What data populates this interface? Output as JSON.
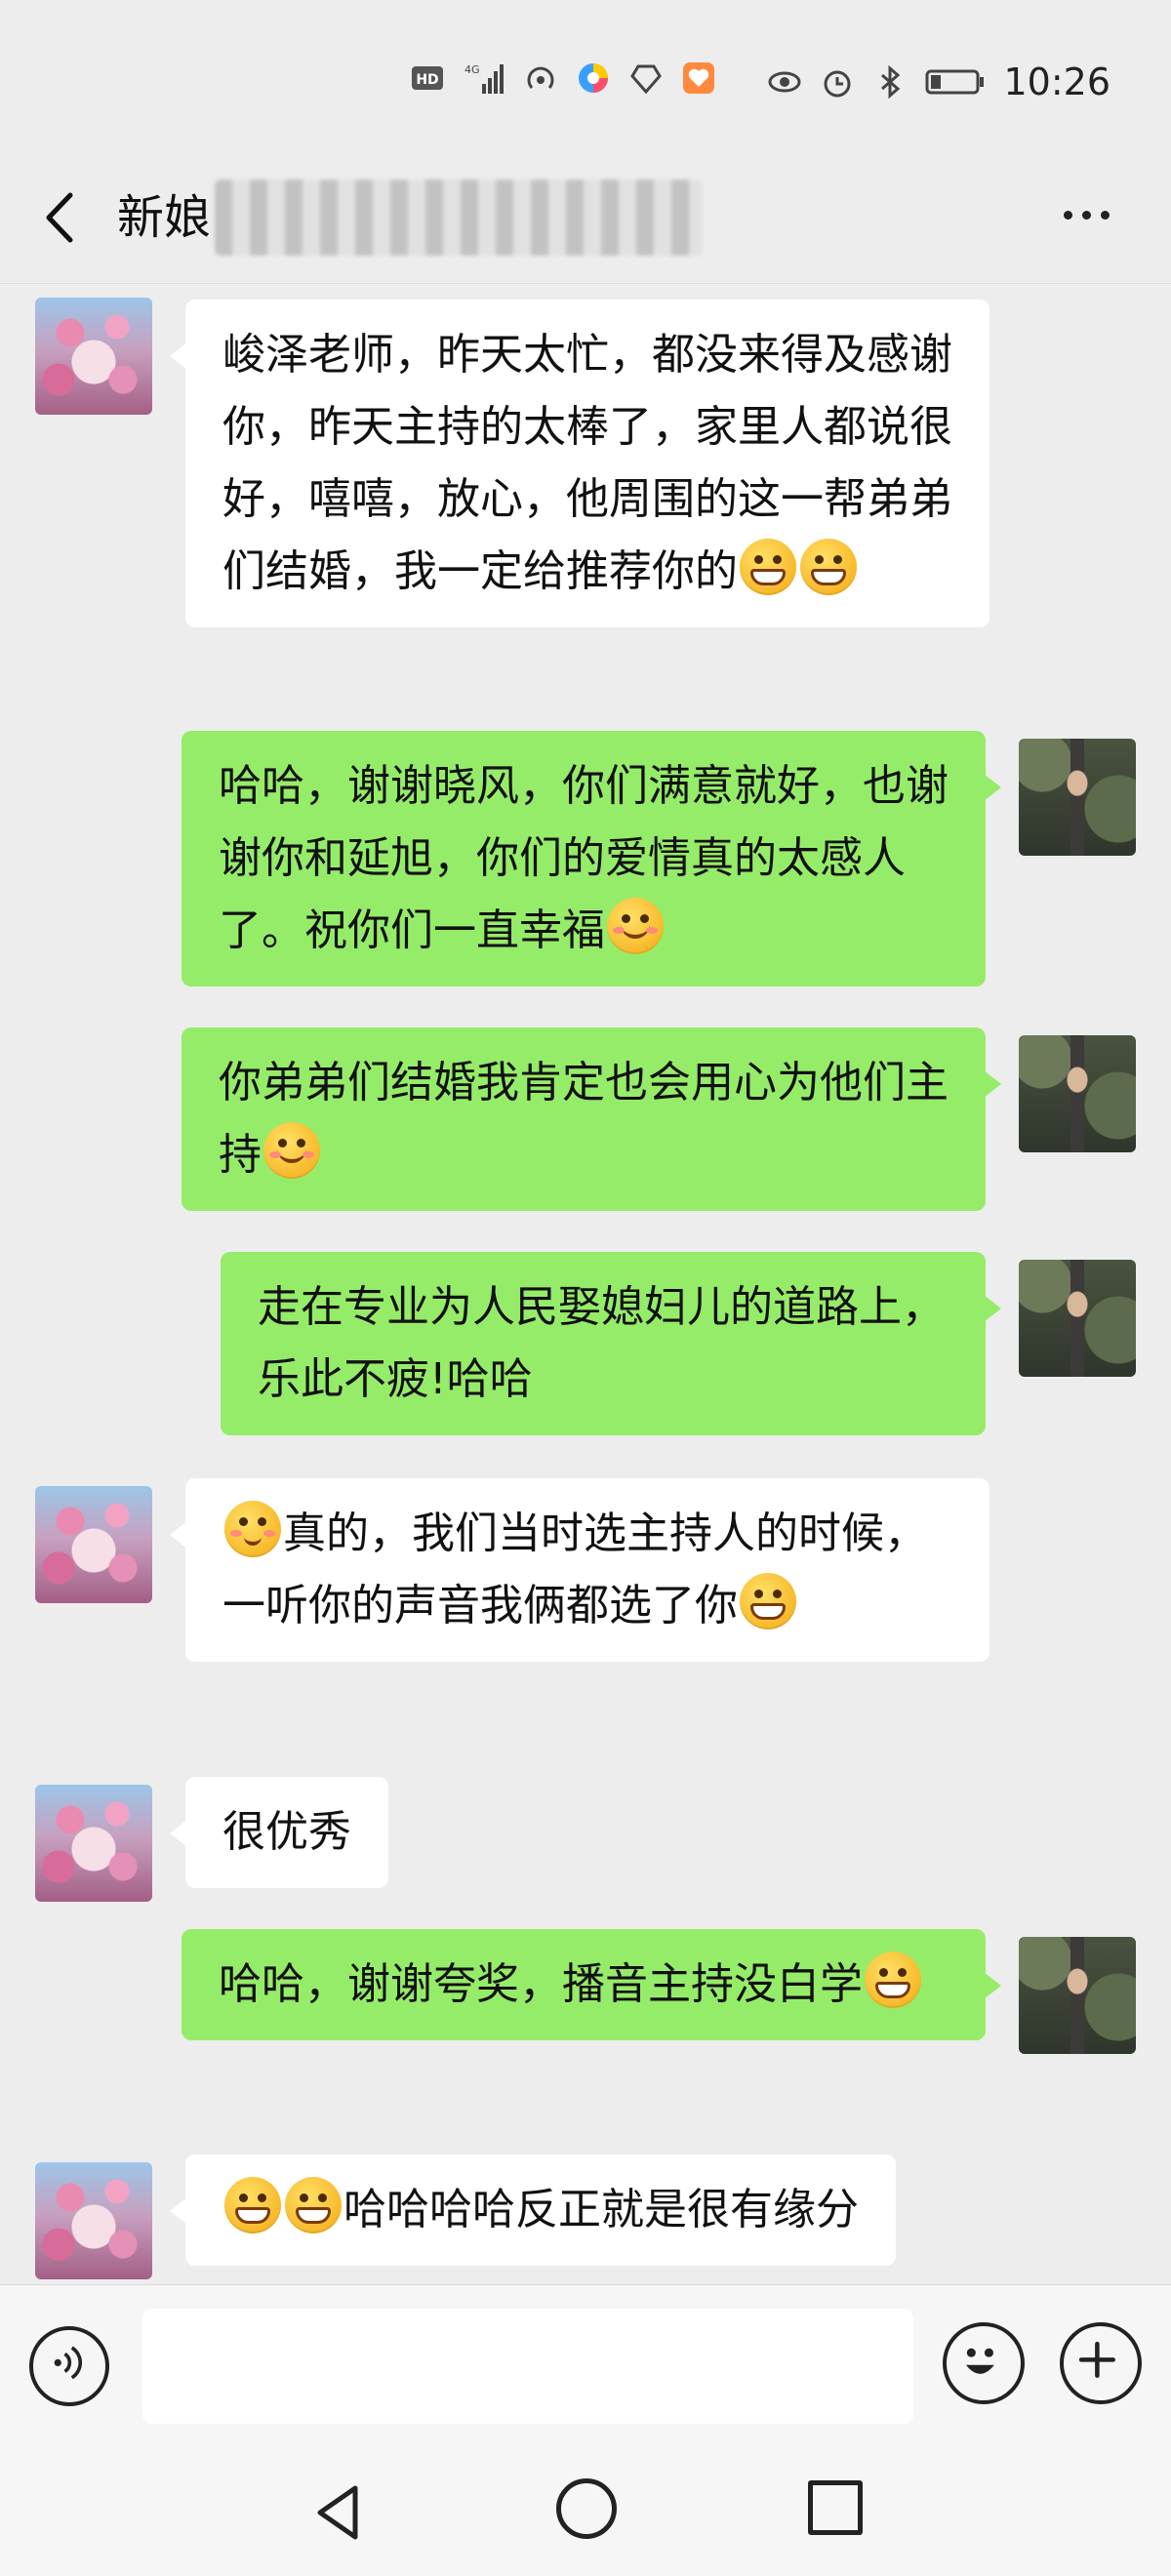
{
  "status_bar": {
    "time": "10:26",
    "left_icons": [
      "hd-icon",
      "signal-4g-icon",
      "hotspot-icon",
      "app-icon-1",
      "app-icon-2",
      "app-icon-3"
    ],
    "right_icons": [
      "eye-icon",
      "alarm-icon",
      "bluetooth-icon",
      "battery-icon"
    ]
  },
  "header": {
    "title": "新娘"
  },
  "messages": [
    {
      "sender": "other",
      "text": "峻泽老师，昨天太忙，都没来得及感谢你，昨天主持的太棒了，家里人都说很好，嘻嘻，放心，他周围的这一帮弟弟们结婚，我一定给推荐你的",
      "emojis": [
        "grin",
        "grin"
      ]
    },
    {
      "sender": "me",
      "text": "哈哈，谢谢晓风，你们满意就好，也谢谢你和延旭，你们的爱情真的太感人了。祝你们一直幸福",
      "emojis": [
        "smile"
      ]
    },
    {
      "sender": "me",
      "text": "你弟弟们结婚我肯定也会用心为他们主持",
      "emojis": [
        "smile"
      ]
    },
    {
      "sender": "me",
      "text": "走在专业为人民娶媳妇儿的道路上，乐此不疲!哈哈",
      "emojis": []
    },
    {
      "sender": "other",
      "text_before": "",
      "text": "真的，我们当时选主持人的时候，一听你的声音我俩都选了你",
      "emojis": [
        "grin"
      ]
    },
    {
      "sender": "other",
      "text": "很优秀",
      "emojis": []
    },
    {
      "sender": "me",
      "text": "哈哈，谢谢夸奖，播音主持没白学",
      "emojis": [
        "grin"
      ]
    },
    {
      "sender": "other",
      "text": "哈哈哈哈反正就是很有缘分",
      "emojis": []
    }
  ],
  "input": {
    "value": "",
    "placeholder": ""
  },
  "colors": {
    "background": "#ededed",
    "my_bubble": "#95ec69",
    "their_bubble": "#ffffff"
  }
}
